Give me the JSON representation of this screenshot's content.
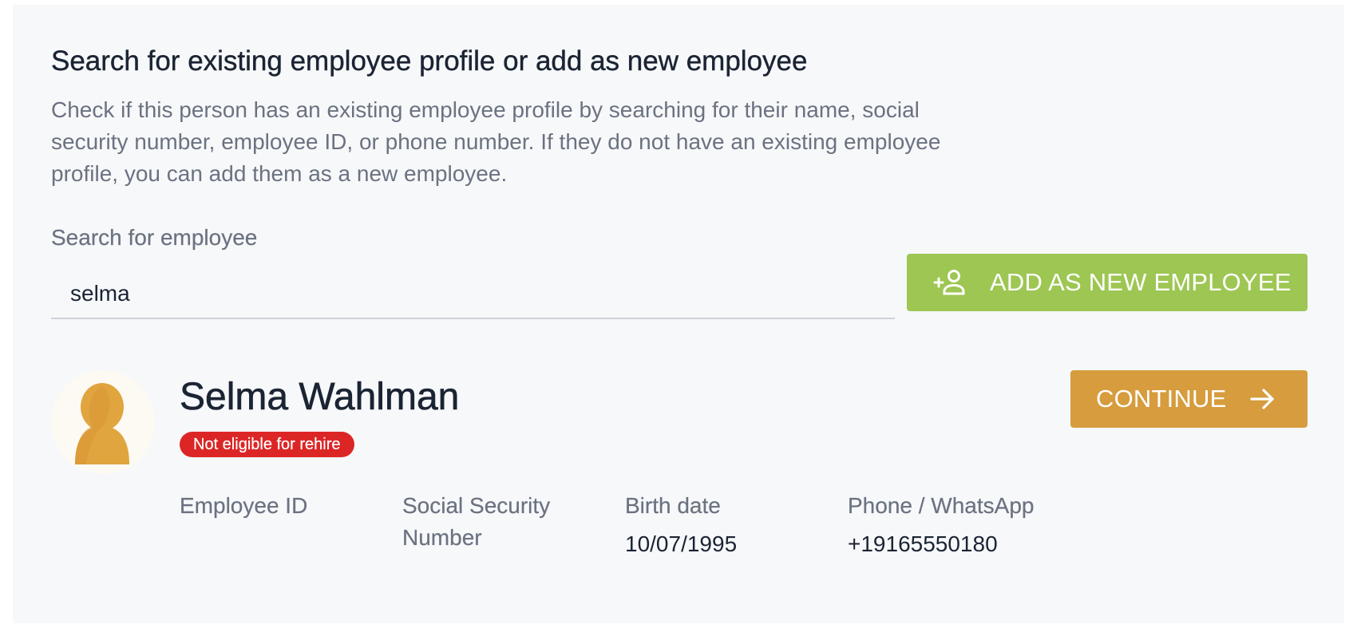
{
  "heading": "Search for existing employee profile or add as new employee",
  "description": "Check if this person has an existing employee profile by searching for their name, social security number, employee ID, or phone number. If they do not have an existing employee profile, you can add them as a new employee.",
  "search": {
    "label": "Search for employee",
    "value": "selma"
  },
  "add_button": {
    "label": "ADD AS NEW EMPLOYEE",
    "icon": "add-person-icon"
  },
  "result": {
    "name": "Selma Wahlman",
    "badge": "Not eligible for rehire",
    "avatar_icon": "person-avatar-icon",
    "continue_label": "CONTINUE",
    "continue_icon": "arrow-right-icon",
    "fields": {
      "employee_id_label": "Employee ID",
      "employee_id_value": "",
      "ssn_label": "Social Security Number",
      "ssn_value": "",
      "birth_date_label": "Birth date",
      "birth_date_value": "10/07/1995",
      "phone_label": "Phone / WhatsApp",
      "phone_value": "+19165550180"
    }
  },
  "colors": {
    "panel_background": "#f7f8fa",
    "add_button": "#9dc653",
    "continue_button": "#d69c3d",
    "badge": "#dc2626",
    "avatar": "#e0a53f"
  }
}
